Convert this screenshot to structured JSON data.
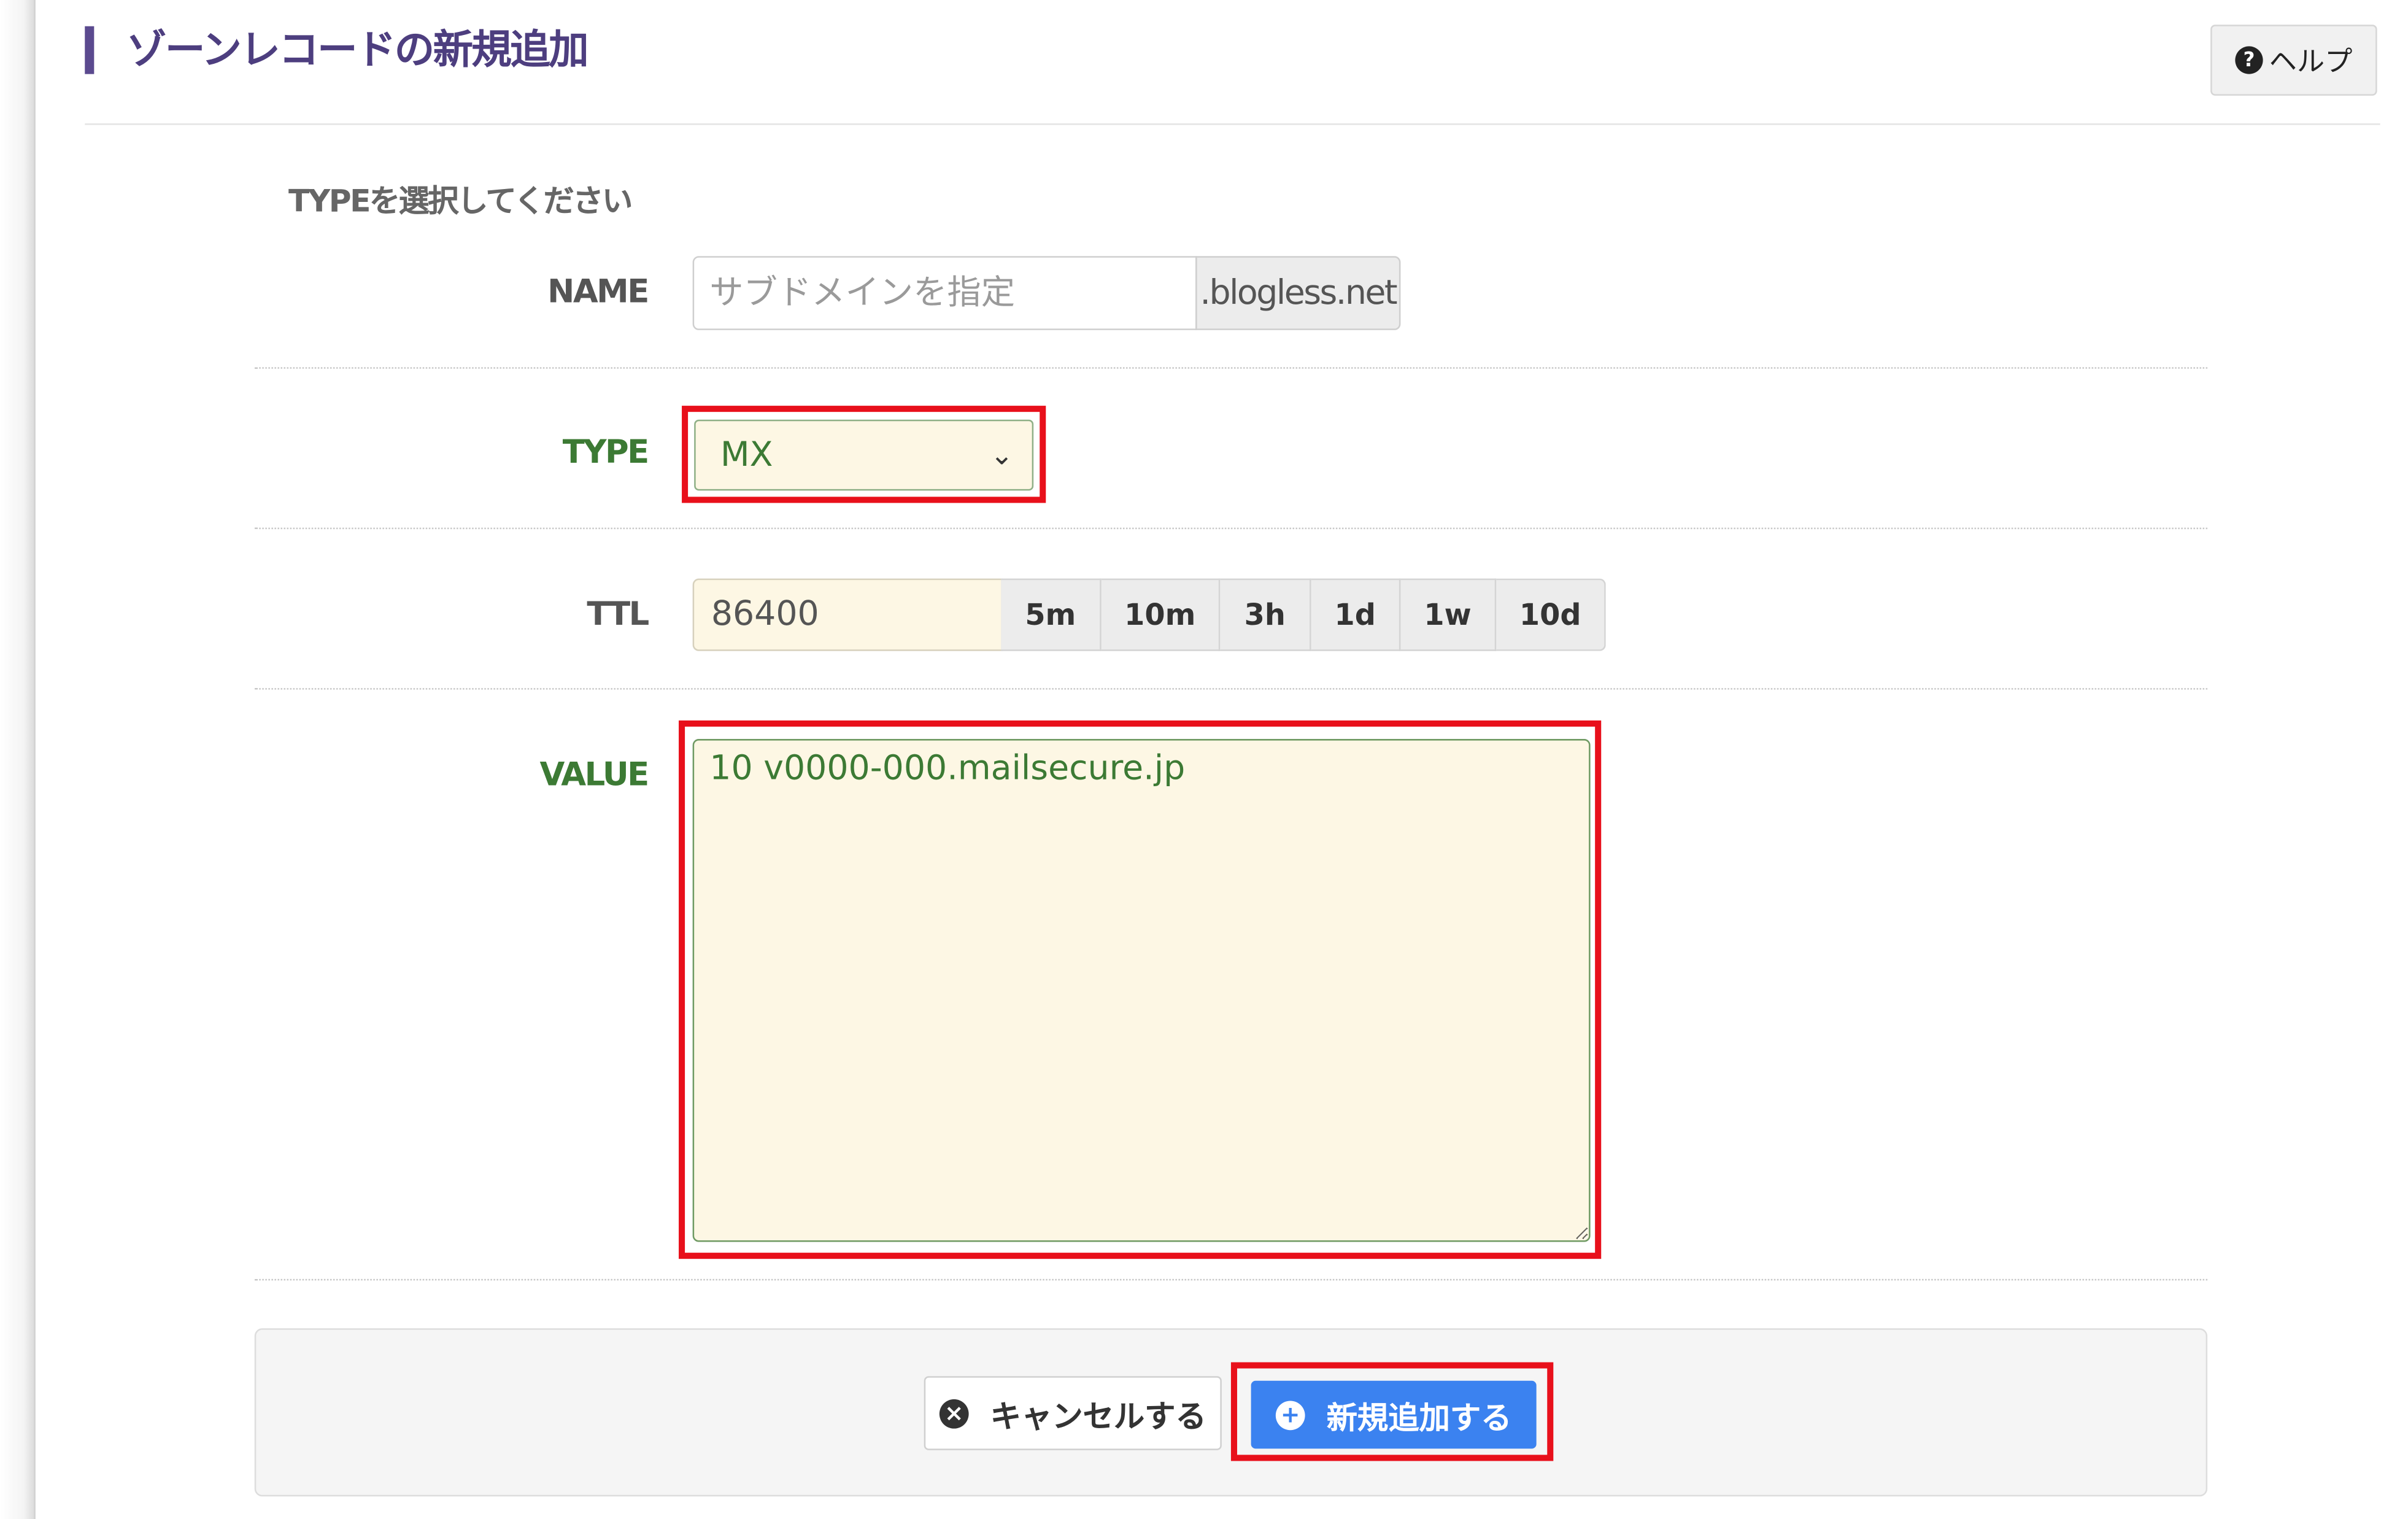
{
  "header": {
    "title": "ゾーンレコードの新規追加",
    "help_label": "ヘルプ",
    "help_icon": "question-circle-icon"
  },
  "instruction": "TYPEを選択してください",
  "form": {
    "name": {
      "label": "NAME",
      "placeholder": "サブドメインを指定",
      "value": "",
      "suffix": ".blogless.net"
    },
    "type": {
      "label": "TYPE",
      "selected": "MX"
    },
    "ttl": {
      "label": "TTL",
      "value": "86400",
      "presets": [
        "5m",
        "10m",
        "3h",
        "1d",
        "1w",
        "10d"
      ]
    },
    "value": {
      "label": "VALUE",
      "text": "10 v0000-000.mailsecure.jp"
    }
  },
  "actions": {
    "cancel_label": "キャンセルする",
    "cancel_icon": "times-circle-icon",
    "submit_label": "新規追加する",
    "submit_icon": "plus-circle-icon"
  },
  "colors": {
    "title": "#4d3e7f",
    "label_green": "#3c7a34",
    "highlight": "#e8101b",
    "primary": "#3b82f0",
    "field_bg": "#fdf7e4"
  }
}
